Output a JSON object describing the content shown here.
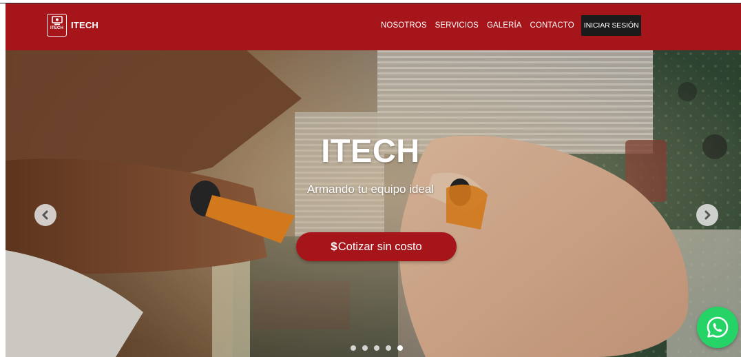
{
  "brand": {
    "name": "ITECH",
    "logo_text": "ITECH",
    "logo_icon": "monitor-icon"
  },
  "nav": {
    "items": [
      {
        "label": "NOSOTROS"
      },
      {
        "label": "SERVICIOS"
      },
      {
        "label": "GALERÍA"
      },
      {
        "label": "CONTACTO"
      }
    ],
    "login_label": "INICIAR SESIÓN"
  },
  "hero": {
    "title": "ITECH",
    "subtitle": "Armando tu equipo ideal",
    "cta_icon": "$",
    "cta_label": "Cotizar sin costo",
    "prev_icon": "chevron-left-icon",
    "next_icon": "chevron-right-icon",
    "slide_count": 5,
    "active_slide": 5
  },
  "whatsapp": {
    "icon": "whatsapp-icon",
    "color": "#25d366"
  },
  "colors": {
    "brand": "#a5151a",
    "login_bg": "#1b1b1b"
  }
}
